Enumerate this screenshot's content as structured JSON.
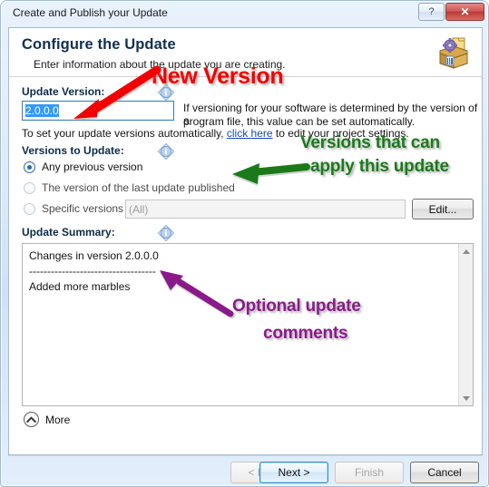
{
  "window": {
    "title": "Create and Publish your Update",
    "caption_buttons": [
      {
        "name": "help-button",
        "glyph": "?"
      },
      {
        "name": "close-button",
        "glyph": "✕"
      }
    ]
  },
  "header": {
    "title": "Configure the Update",
    "subtitle": "Enter information about the update you are creating.",
    "icon": "package-gear-icon"
  },
  "update_version": {
    "label": "Update Version:",
    "info_icon": "info-diamond-icon",
    "value": "2.0.0.0",
    "hint_line1": "If versioning for your software is determined by the version of a",
    "hint_line2": "program file, this value can be set automatically.",
    "auto_prefix": "To set your update versions automatically, ",
    "auto_link": "click here",
    "auto_suffix": " to edit your project settings."
  },
  "versions_to_update": {
    "label": "Versions to Update:",
    "info_icon": "info-diamond-icon",
    "options": [
      {
        "label": "Any previous version",
        "selected": true
      },
      {
        "label": "The version of the last update published",
        "selected": false
      },
      {
        "label": "Specific versions",
        "selected": false
      }
    ],
    "specific_value": "(All)",
    "edit_button": "Edit..."
  },
  "update_summary": {
    "label": "Update Summary:",
    "info_icon": "info-diamond-icon",
    "text": "Changes in version 2.0.0.0\n-----------------------------------\nAdded more marbles",
    "scrollbar": {
      "up": "scroll-up-arrow",
      "down": "scroll-down-arrow"
    }
  },
  "more": {
    "label": "More",
    "icon": "chevron-up-circle-icon"
  },
  "footer": {
    "buttons": [
      {
        "name": "back-button",
        "label": "< Back",
        "state": "disabled"
      },
      {
        "name": "next-button",
        "label": "Next >",
        "state": "default"
      },
      {
        "name": "finish-button",
        "label": "Finish",
        "state": "disabled"
      },
      {
        "name": "cancel-button",
        "label": "Cancel",
        "state": "normal"
      }
    ]
  },
  "annotations": [
    {
      "name": "annotation-new-version",
      "text": "New Version",
      "color": "#f20000",
      "arrow": "red-arrow-down-left"
    },
    {
      "name": "annotation-versions-apply",
      "line1": "Versions that can",
      "line2": "apply this update",
      "color": "#1a7a1a",
      "arrow": "green-arrow-left"
    },
    {
      "name": "annotation-optional-comments",
      "line1": "Optional update",
      "line2": "comments",
      "color": "#8a1a8a",
      "arrow": "purple-arrow-up-left"
    }
  ]
}
